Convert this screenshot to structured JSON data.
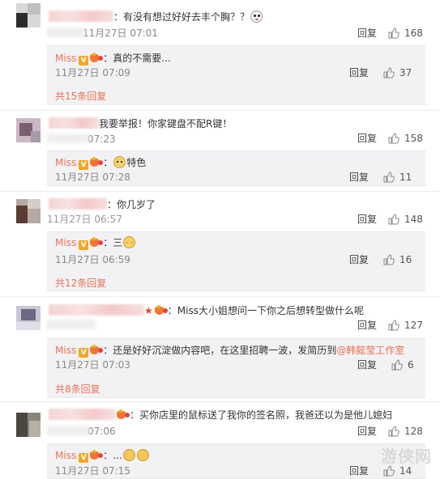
{
  "comments": [
    {
      "text": "：有没有想过好好去丰个胸？？",
      "time_suffix": "11月27日 07:01",
      "reply_label": "回复",
      "likes": "168",
      "sub_reply": {
        "name": "Miss",
        "text": "：真的不需要...",
        "time": "11月27日 07:09",
        "reply_label": "回复",
        "likes": "37"
      },
      "more": "共15条回复"
    },
    {
      "text": "我要举报！你家键盘不配R键！",
      "time_suffix": "07:23",
      "reply_label": "回复",
      "likes": "158",
      "sub_reply": {
        "name": "Miss",
        "text": "特色",
        "time": "11月27日 07:28",
        "reply_label": "回复",
        "likes": "11"
      },
      "more": ""
    },
    {
      "text": "：你几岁了",
      "time_suffix": "11月27日 06:57",
      "reply_label": "回复",
      "likes": "148",
      "sub_reply": {
        "name": "Miss",
        "text": "：三",
        "time": "11月27日 06:59",
        "reply_label": "回复",
        "likes": "16"
      },
      "more": "共12条回复"
    },
    {
      "text": "：Miss大小姐想问一下你之后想转型做什么呢",
      "time_suffix": "",
      "reply_label": "回复",
      "likes": "127",
      "sub_reply": {
        "name": "Miss",
        "text": "：还是好好沉淀做内容吧，在这里招聘一波，发简历到",
        "mention": "@韩懿莹工作室",
        "time": "11月27日 07:03",
        "reply_label": "回复",
        "likes": "6"
      },
      "more": "共8条回复"
    },
    {
      "text": "：买你店里的鼠标送了我你的签名照，我爸还以为是他儿媳妇",
      "time_suffix": "07:06",
      "reply_label": "回复",
      "likes": "128",
      "sub_reply": {
        "name": "Miss",
        "text": "：...",
        "time": "11月27日 07:15",
        "reply_label": "回复",
        "likes": "14"
      },
      "more": ""
    }
  ],
  "badges": {
    "v": "V"
  },
  "watermark": "游侠网",
  "colors": {
    "accent": "#eb7350",
    "reply_bg": "#f2f2f5",
    "text": "#333333",
    "muted": "#888888"
  },
  "icons": {
    "like": "thumbs-up-icon",
    "vip": "vip-crown-icon",
    "emoji": "face-emoji-icon"
  }
}
